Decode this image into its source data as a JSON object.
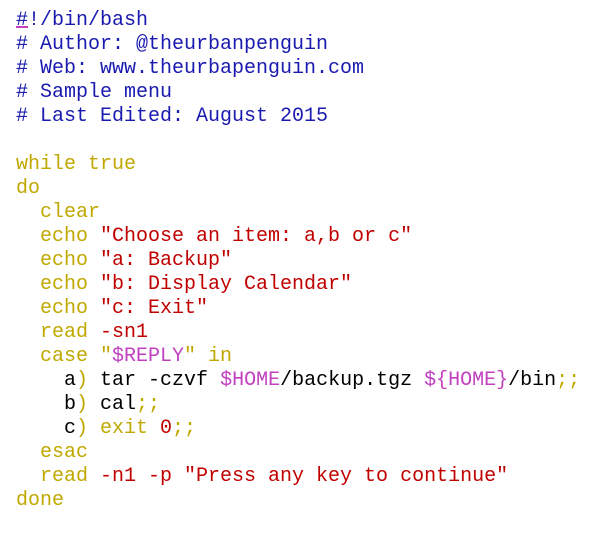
{
  "editor": {
    "language": "bash",
    "colors": {
      "comment": "#1a1ab0",
      "keyword": "#c0a800",
      "string": "#c00000",
      "variable": "#c040c0",
      "plain": "#000000"
    },
    "lines": [
      [
        [
          "shebang-mark",
          "#"
        ],
        [
          "comment",
          "!/bin/bash"
        ]
      ],
      [
        [
          "comment",
          "# Author: @theurbanpenguin"
        ]
      ],
      [
        [
          "comment",
          "# Web: www.theurbapenguin.com"
        ]
      ],
      [
        [
          "comment",
          "# Sample menu"
        ]
      ],
      [
        [
          "comment",
          "# Last Edited: August 2015"
        ]
      ],
      [],
      [
        [
          "keyword",
          "while true"
        ]
      ],
      [
        [
          "keyword",
          "do"
        ]
      ],
      [
        [
          "keyword",
          "  clear"
        ]
      ],
      [
        [
          "keyword",
          "  echo "
        ],
        [
          "string",
          "\"Choose an item: a,b or c\""
        ]
      ],
      [
        [
          "keyword",
          "  echo "
        ],
        [
          "string",
          "\"a: Backup\""
        ]
      ],
      [
        [
          "keyword",
          "  echo "
        ],
        [
          "string",
          "\"b: Display Calendar\""
        ]
      ],
      [
        [
          "keyword",
          "  echo "
        ],
        [
          "string",
          "\"c: Exit\""
        ]
      ],
      [
        [
          "keyword",
          "  read "
        ],
        [
          "string",
          "-sn1"
        ]
      ],
      [
        [
          "keyword",
          "  case "
        ],
        [
          "keyword",
          "\""
        ],
        [
          "variable",
          "$REPLY"
        ],
        [
          "keyword",
          "\" in"
        ]
      ],
      [
        [
          "plain",
          "    a"
        ],
        [
          "keyword",
          ")"
        ],
        [
          "plain",
          " tar -czvf "
        ],
        [
          "variable",
          "$HOME"
        ],
        [
          "plain",
          "/backup.tgz "
        ],
        [
          "variable",
          "${HOME}"
        ],
        [
          "plain",
          "/bin"
        ],
        [
          "keyword",
          ";;"
        ]
      ],
      [
        [
          "plain",
          "    b"
        ],
        [
          "keyword",
          ")"
        ],
        [
          "plain",
          " cal"
        ],
        [
          "keyword",
          ";;"
        ]
      ],
      [
        [
          "plain",
          "    c"
        ],
        [
          "keyword",
          ") exit "
        ],
        [
          "number",
          "0"
        ],
        [
          "keyword",
          ";;"
        ]
      ],
      [
        [
          "keyword",
          "  esac"
        ]
      ],
      [
        [
          "keyword",
          "  read "
        ],
        [
          "string",
          "-n1 -p \"Press any key to continue\""
        ]
      ],
      [
        [
          "keyword",
          "done"
        ]
      ]
    ]
  }
}
